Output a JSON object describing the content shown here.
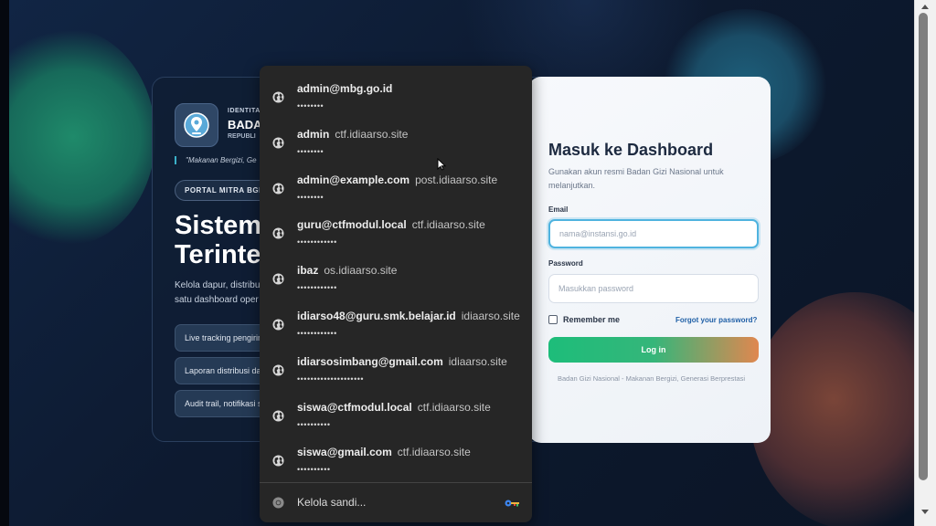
{
  "branding": {
    "identity_line": "IDENTITA",
    "name_line": "BADA",
    "republic_line": "REPUBLI",
    "tagline": "\"Makanan Bergizi, Ge",
    "portal_badge": "PORTAL MITRA BGN",
    "hero_line1": "Sistem",
    "hero_line2": "Terinte",
    "desc_line1": "Kelola dapur, distribu",
    "desc_line2": "satu dashboard oper",
    "features": [
      "Live tracking pengirim",
      "Laporan distribusi dar",
      "Audit trail, notifikasi s"
    ]
  },
  "login": {
    "title": "Masuk ke Dashboard",
    "subtitle": "Gunakan akun resmi Badan Gizi Nasional untuk melanjutkan.",
    "email_label": "Email",
    "email_placeholder": "nama@instansi.go.id",
    "password_label": "Password",
    "password_placeholder": "Masukkan password",
    "remember_label": "Remember me",
    "forgot_label": "Forgot your password?",
    "login_button": "Log in",
    "footer": "Badan Gizi Nasional - Makanan Bergizi, Generasi Berprestasi"
  },
  "autofill": {
    "entries": [
      {
        "username": "admin@mbg.go.id",
        "site": "",
        "password_mask": "••••••••"
      },
      {
        "username": "admin",
        "site": "ctf.idiaarso.site",
        "password_mask": "••••••••"
      },
      {
        "username": "admin@example.com",
        "site": "post.idiaarso.site",
        "password_mask": "••••••••"
      },
      {
        "username": "guru@ctfmodul.local",
        "site": "ctf.idiaarso.site",
        "password_mask": "••••••••••••"
      },
      {
        "username": "ibaz",
        "site": "os.idiaarso.site",
        "password_mask": "••••••••••••"
      },
      {
        "username": "idiarso48@guru.smk.belajar.id",
        "site": "idiaarso.site",
        "password_mask": "••••••••••••"
      },
      {
        "username": "idiarsosimbang@gmail.com",
        "site": "idiaarso.site",
        "password_mask": "••••••••••••••••••••"
      },
      {
        "username": "siswa@ctfmodul.local",
        "site": "ctf.idiaarso.site",
        "password_mask": "••••••••••"
      },
      {
        "username": "siswa@gmail.com",
        "site": "ctf.idiaarso.site",
        "password_mask": "••••••••••"
      }
    ],
    "manage_label": "Kelola sandi..."
  },
  "icons": {
    "entry_icon": "globe-icon",
    "manage_icon": "chrome-icon",
    "key_icon": "password-key-icon"
  },
  "colors": {
    "accent_green": "#1dbd7a",
    "accent_orange": "#e0874f",
    "focus_blue": "#4fb3df",
    "dropdown_bg": "#262626"
  }
}
